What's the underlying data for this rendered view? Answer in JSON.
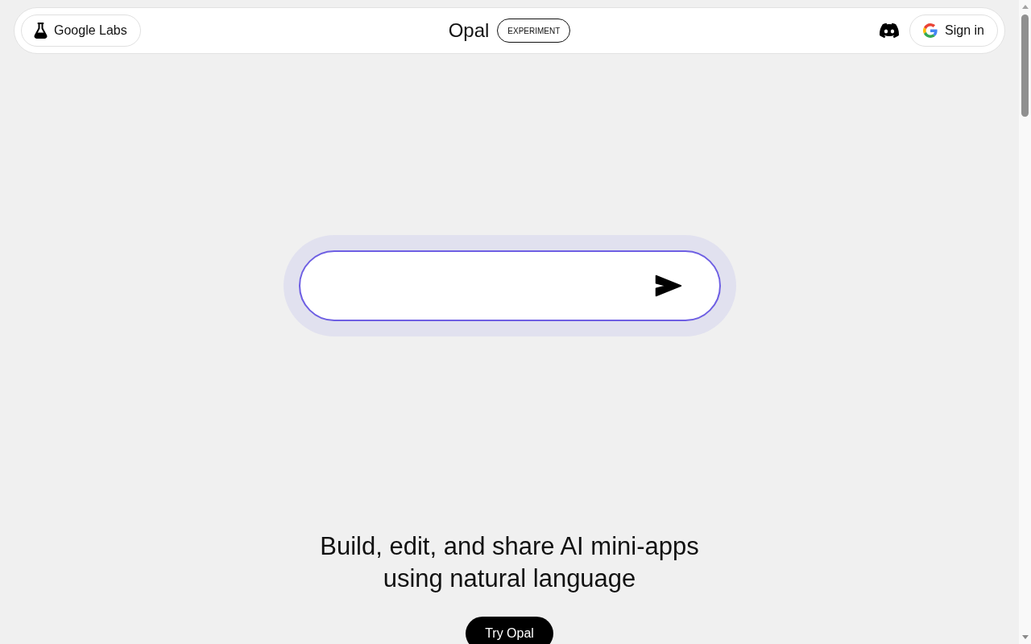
{
  "header": {
    "labs_button": "Google Labs",
    "title": "Opal",
    "badge": "EXPERIMENT",
    "sign_in_button": "Sign in"
  },
  "prompt_box": {
    "focused": true
  },
  "hero": {
    "headline": "Build, edit, and share AI mini-apps using natural language",
    "cta_button": "Try Opal"
  }
}
